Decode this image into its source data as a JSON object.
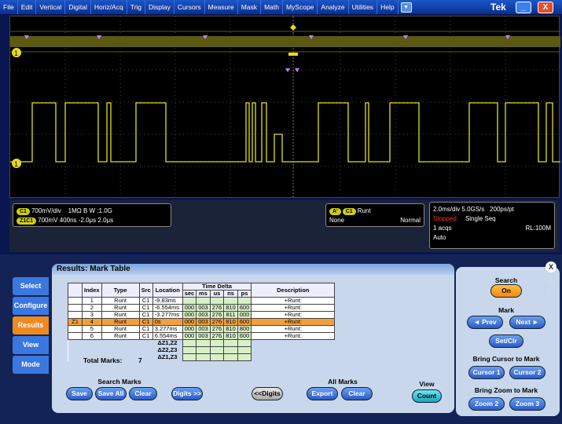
{
  "menu": [
    "File",
    "Edit",
    "Vertical",
    "Digital",
    "Horiz/Acq",
    "Trig",
    "Display",
    "Cursors",
    "Measure",
    "Mask",
    "Math",
    "MyScope",
    "Analyze",
    "Utilities",
    "Help"
  ],
  "brand": "Tek",
  "window": {
    "minimize": "_",
    "close": "X"
  },
  "waveform": {
    "channel_marker": "1",
    "color": "#d8d820"
  },
  "info": {
    "ch1_chip": "C1",
    "ch1_scale": "700mV/div",
    "ch1_coupling": "1MΩ",
    "ch1_bw": "B W :1.0G",
    "zoom_chip": "Z1C1",
    "zoom_vscale": "700mV",
    "zoom_hscale": "400ns",
    "zoom_pos": "-2.0μs",
    "zoom_len": "2.0μs",
    "trig_a": "A'",
    "trig_chip": "C1",
    "trig_type": "Runt",
    "trig_none": "None",
    "trig_mode": "Normal",
    "horiz_scale": "2.0ms/div",
    "sample_rate": "5.0GS/s",
    "resolution": "200ps/pt",
    "status": "Stopped",
    "seq": "Single Seq",
    "acqs": "1 acqs",
    "rl": "RL:100M",
    "auto": "Auto"
  },
  "nav": [
    "Select",
    "Configure",
    "Results",
    "View",
    "Mode"
  ],
  "results": {
    "title": "Results: Mark Table",
    "headers": {
      "index": "Index",
      "type": "Type",
      "src": "Src",
      "location": "Location",
      "time_delta": "Time Delta",
      "sec": "sec",
      "ms": "ms",
      "us": "us",
      "ns": "ns",
      "ps": "ps",
      "description": "Description"
    },
    "rows": [
      {
        "z": "",
        "index": "1",
        "type": "Runt",
        "src": "C1",
        "loc": "-9.83ms",
        "sec": "",
        "ms": "",
        "us": "",
        "ns": "",
        "ps": "",
        "desc": "+Runt:"
      },
      {
        "z": "",
        "index": "2",
        "type": "Runt",
        "src": "C1",
        "loc": "-6.554ms",
        "sec": "000",
        "ms": "003",
        "us": "276",
        "ns": "810",
        "ps": "600",
        "desc": "+Runt:"
      },
      {
        "z": "",
        "index": "3",
        "type": "Runt",
        "src": "C1",
        "loc": "-3.277ms",
        "sec": "000",
        "ms": "003",
        "us": "276",
        "ns": "811",
        "ps": "000",
        "desc": "+Runt:"
      },
      {
        "z": "Z1",
        "index": "4",
        "type": "Runt",
        "src": "C1",
        "loc": "0s",
        "sec": "000",
        "ms": "003",
        "us": "276",
        "ns": "810",
        "ps": "600",
        "desc": "+Runt:"
      },
      {
        "z": "",
        "index": "5",
        "type": "Runt",
        "src": "C1",
        "loc": "3.277ms",
        "sec": "000",
        "ms": "003",
        "us": "276",
        "ns": "810",
        "ps": "800",
        "desc": "+Runt:"
      },
      {
        "z": "",
        "index": "6",
        "type": "Runt",
        "src": "C1",
        "loc": "6.554ms",
        "sec": "000",
        "ms": "003",
        "us": "276",
        "ns": "810",
        "ps": "600",
        "desc": "+Runt:"
      }
    ],
    "deltas": [
      "ΔZ1,Z2",
      "ΔZ2,Z3",
      "ΔZ1,Z3"
    ],
    "total_label": "Total Marks:",
    "total_value": "7",
    "search_marks_label": "Search Marks",
    "all_marks_label": "All Marks",
    "view_label": "View",
    "buttons": {
      "save": "Save",
      "save_all": "Save All",
      "clear": "Clear",
      "digits_more": "Digits >>",
      "digits_less": "<<Digits",
      "export": "Export",
      "clear2": "Clear",
      "count": "Count"
    }
  },
  "right": {
    "search": "Search",
    "on": "On",
    "mark": "Mark",
    "prev": "◄ Prev",
    "next": "Next ►",
    "setclr": "Set/Clr",
    "bring_cursor": "Bring Cursor to Mark",
    "cursor1": "Cursor 1",
    "cursor2": "Cursor 2",
    "bring_zoom": "Bring Zoom to Mark",
    "zoom2": "Zoom 2",
    "zoom3": "Zoom 3",
    "close": "X"
  }
}
